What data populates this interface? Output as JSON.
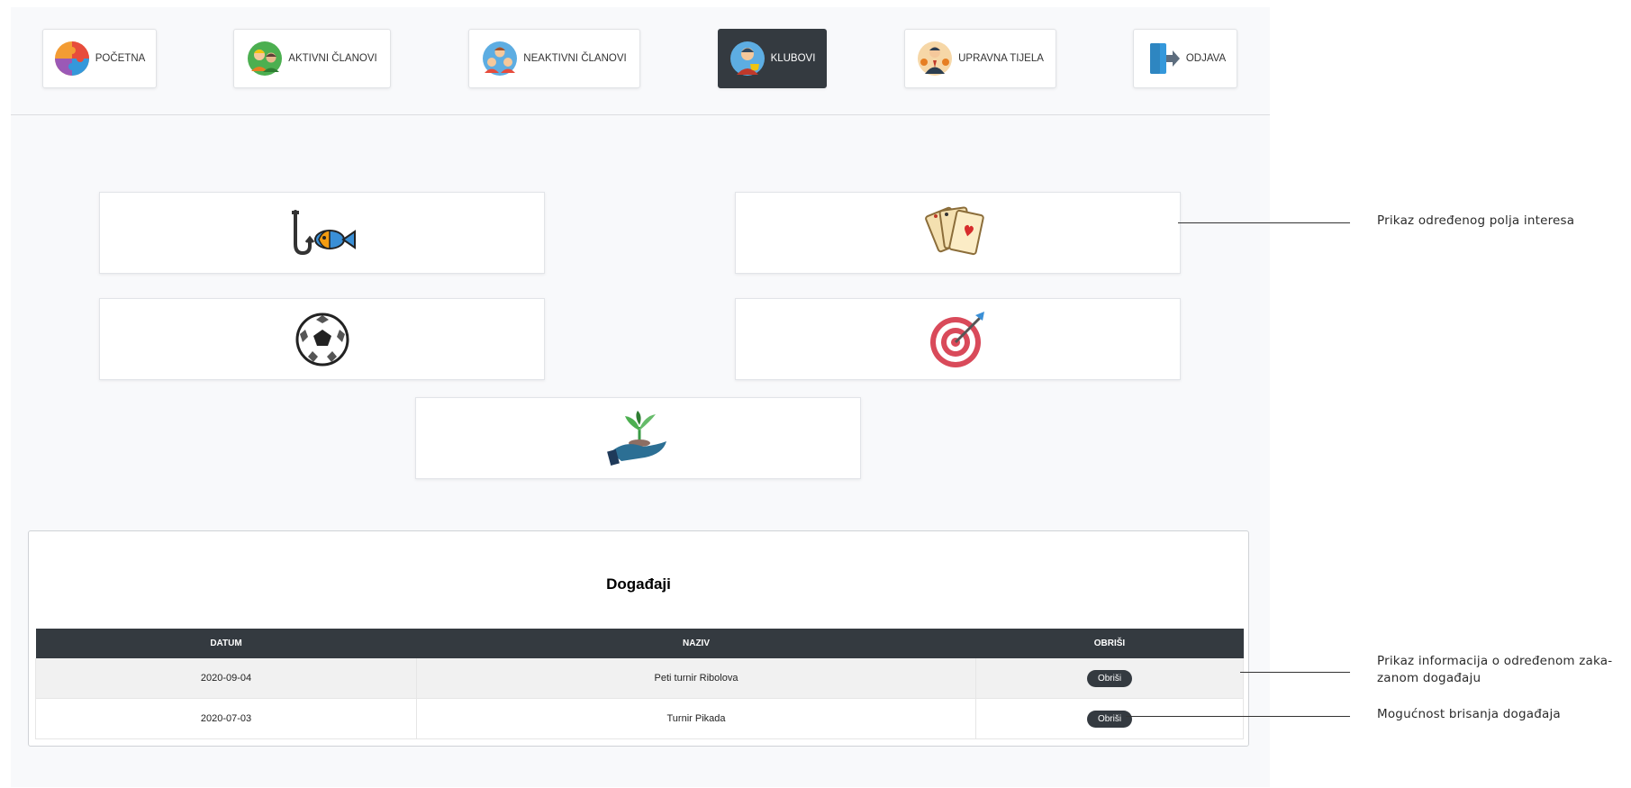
{
  "nav": {
    "items": [
      {
        "label": "POČETNA",
        "icon": "puzzle-icon",
        "active": false
      },
      {
        "label": "AKTIVNI ČLANOVI",
        "icon": "active-members-icon",
        "active": false
      },
      {
        "label": "NEAKTIVNI ČLANOVI",
        "icon": "inactive-members-icon",
        "active": false
      },
      {
        "label": "KLUBOVI",
        "icon": "clubs-trophy-icon",
        "active": true
      },
      {
        "label": "UPRAVNA TIJELA",
        "icon": "governing-bodies-icon",
        "active": false
      },
      {
        "label": "ODJAVA",
        "icon": "logout-door-icon",
        "active": false
      }
    ]
  },
  "clubs": [
    {
      "icon": "fishing-icon"
    },
    {
      "icon": "playing-cards-icon"
    },
    {
      "icon": "soccer-ball-icon"
    },
    {
      "icon": "darts-target-icon"
    },
    {
      "icon": "hand-plant-icon"
    }
  ],
  "events": {
    "title": "Događaji",
    "columns": [
      "DATUM",
      "NAZIV",
      "OBRIŠI"
    ],
    "rows": [
      {
        "date": "2020-09-04",
        "name": "Peti turnir Ribolova",
        "action": "Obriši"
      },
      {
        "date": "2020-07-03",
        "name": "Turnir Pikada",
        "action": "Obriši"
      }
    ]
  },
  "annotations": [
    "Prikaz određenog polja interesa",
    "Prikaz informacija o određenom zaka-",
    "zanom događaju",
    "Mogućnost brisanja događaja"
  ],
  "colors": {
    "dark": "#343a40",
    "background": "#f8f9fb",
    "row_stripe": "#f1f1f1"
  }
}
